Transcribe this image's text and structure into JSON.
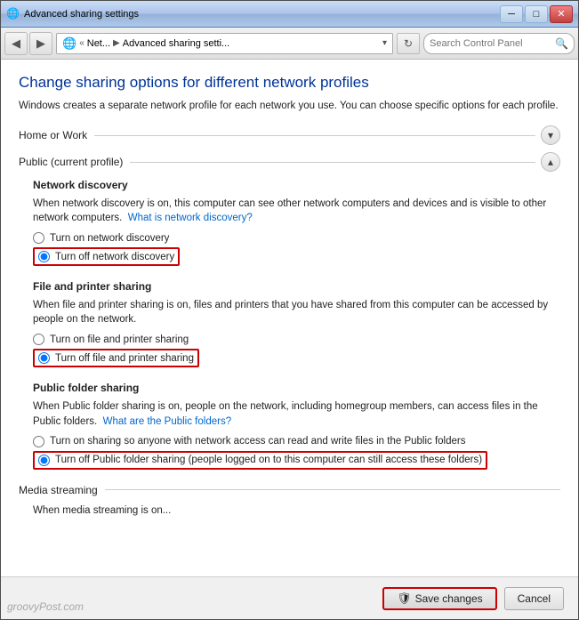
{
  "window": {
    "title": "Advanced sharing settings",
    "title_icon": "🌐"
  },
  "address_bar": {
    "path_parts": [
      "Net...",
      "Advanced sharing setti..."
    ],
    "search_placeholder": "Search Control Panel"
  },
  "page": {
    "title": "Change sharing options for different network profiles",
    "description": "Windows creates a separate network profile for each network you use. You can choose specific options for each profile."
  },
  "sections": [
    {
      "id": "home_work",
      "title": "Home or Work",
      "collapsed": true,
      "toggle_icon": "▾"
    },
    {
      "id": "public",
      "title": "Public (current profile)",
      "collapsed": false,
      "toggle_icon": "▴",
      "subsections": [
        {
          "id": "network_discovery",
          "title": "Network discovery",
          "description": "When network discovery is on, this computer can see other network computers and devices and is visible to other network computers.",
          "link_text": "What is network discovery?",
          "options": [
            {
              "id": "on_discovery",
              "label": "Turn on network discovery",
              "selected": false
            },
            {
              "id": "off_discovery",
              "label": "Turn off network discovery",
              "selected": true,
              "highlighted": true
            }
          ]
        },
        {
          "id": "file_printer",
          "title": "File and printer sharing",
          "description": "When file and printer sharing is on, files and printers that you have shared from this computer can be accessed by people on the network.",
          "link_text": null,
          "options": [
            {
              "id": "on_printer",
              "label": "Turn on file and printer sharing",
              "selected": false
            },
            {
              "id": "off_printer",
              "label": "Turn off file and printer sharing",
              "selected": true,
              "highlighted": true
            }
          ]
        },
        {
          "id": "public_folder",
          "title": "Public folder sharing",
          "description": "When Public folder sharing is on, people on the network, including homegroup members, can access files in the Public folders.",
          "link_text": "What are the Public folders?",
          "options": [
            {
              "id": "on_folder",
              "label": "Turn on sharing so anyone with network access can read and write files in the Public folders",
              "selected": false
            },
            {
              "id": "off_folder",
              "label": "Turn off Public folder sharing (people logged on to this computer can still access these folders)",
              "selected": true,
              "highlighted": true
            }
          ]
        },
        {
          "id": "media_streaming",
          "title": "Media streaming",
          "description": "When media streaming is on...",
          "partial": true
        }
      ]
    }
  ],
  "buttons": {
    "save_label": "Save changes",
    "cancel_label": "Cancel",
    "save_icon": "🛡"
  },
  "watermark": "groovyPost.com"
}
